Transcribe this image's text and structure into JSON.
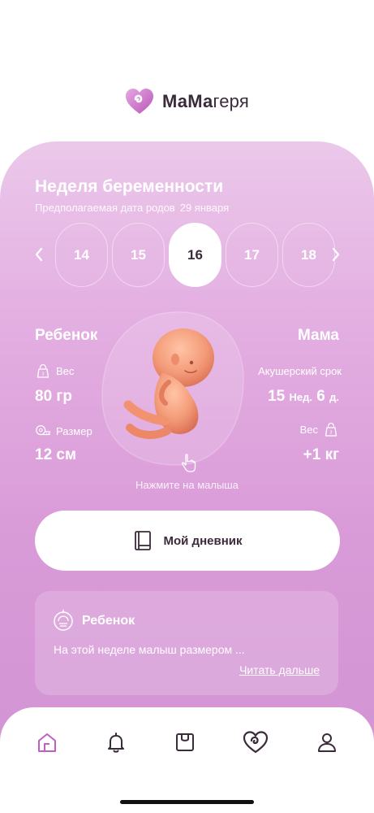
{
  "app": {
    "brand_bold": "МаМа",
    "brand_light": "геря"
  },
  "pregnancy": {
    "title": "Неделя беременности",
    "due_label": "Предполагаемая дата родов",
    "due_date": "29 января",
    "weeks": [
      "14",
      "15",
      "16",
      "17",
      "18"
    ],
    "active_week": "16",
    "tap_hint": "Нажмите на малыша"
  },
  "baby": {
    "title": "Ребенок",
    "weight_label": "Вес",
    "weight_value": "80 гр",
    "size_label": "Размер",
    "size_value": "12 см"
  },
  "mom": {
    "title": "Мама",
    "term_label": "Акушерский срок",
    "term_weeks": "15",
    "term_weeks_unit": "Нед.",
    "term_days": "6",
    "term_days_unit": "д.",
    "weight_label": "Вес",
    "weight_value": "+1 кг"
  },
  "diary": {
    "label": "Мой дневник"
  },
  "info_card": {
    "title": "Ребенок",
    "text": "На этой неделе малыш размером ...",
    "link": "Читать дальше"
  },
  "nav": {
    "items": [
      "home-icon",
      "bell-icon",
      "bag-icon",
      "heart-icon",
      "profile-icon"
    ],
    "active_color": "#c05fbf",
    "icon_color": "#3b2a3a"
  },
  "colors": {
    "brand": "#c05fbf",
    "card_top": "#ebc8ea",
    "card_bottom": "#d294d3",
    "text_dark": "#3b2a3a"
  }
}
